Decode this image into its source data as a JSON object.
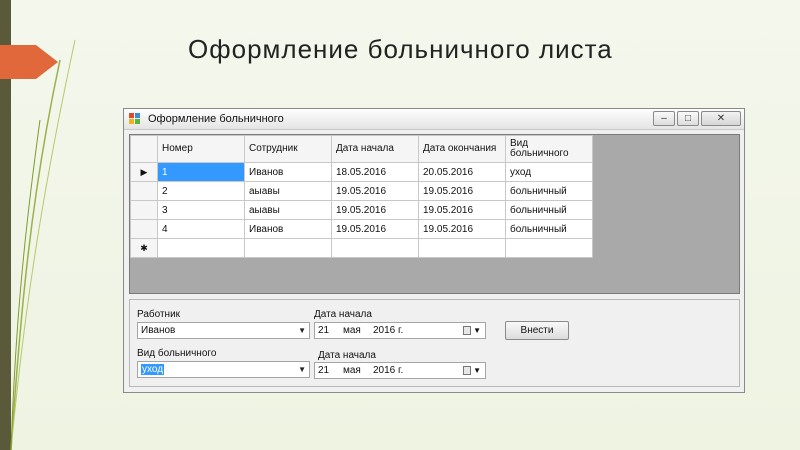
{
  "slide": {
    "title": "Оформление больничного листа"
  },
  "window": {
    "title": "Оформление больничного",
    "buttons": {
      "minimize": "–",
      "maximize": "□",
      "close": "✕"
    }
  },
  "grid": {
    "columns": [
      "Номер",
      "Сотрудник",
      "Дата начала",
      "Дата окончания",
      "Вид больничного"
    ],
    "rows": [
      [
        "1",
        "Иванов",
        "18.05.2016",
        "20.05.2016",
        "уход"
      ],
      [
        "2",
        "аыавы",
        "19.05.2016",
        "19.05.2016",
        "больничный"
      ],
      [
        "3",
        "аыавы",
        "19.05.2016",
        "19.05.2016",
        "больничный"
      ],
      [
        "4",
        "Иванов",
        "19.05.2016",
        "19.05.2016",
        "больничный"
      ]
    ],
    "current_row_marker": "▶",
    "new_row_marker": "✱"
  },
  "form": {
    "worker_label": "Работник",
    "worker_value": "Иванов",
    "type_label": "Вид больничного",
    "type_value": "уход",
    "start_label_1": "Дата начала",
    "start_label_2": "Дата начала",
    "date1": {
      "day": "21",
      "month": "мая",
      "year": "2016 г."
    },
    "date2": {
      "day": "21",
      "month": "мая",
      "year": "2016 г."
    },
    "submit_label": "Внести"
  }
}
